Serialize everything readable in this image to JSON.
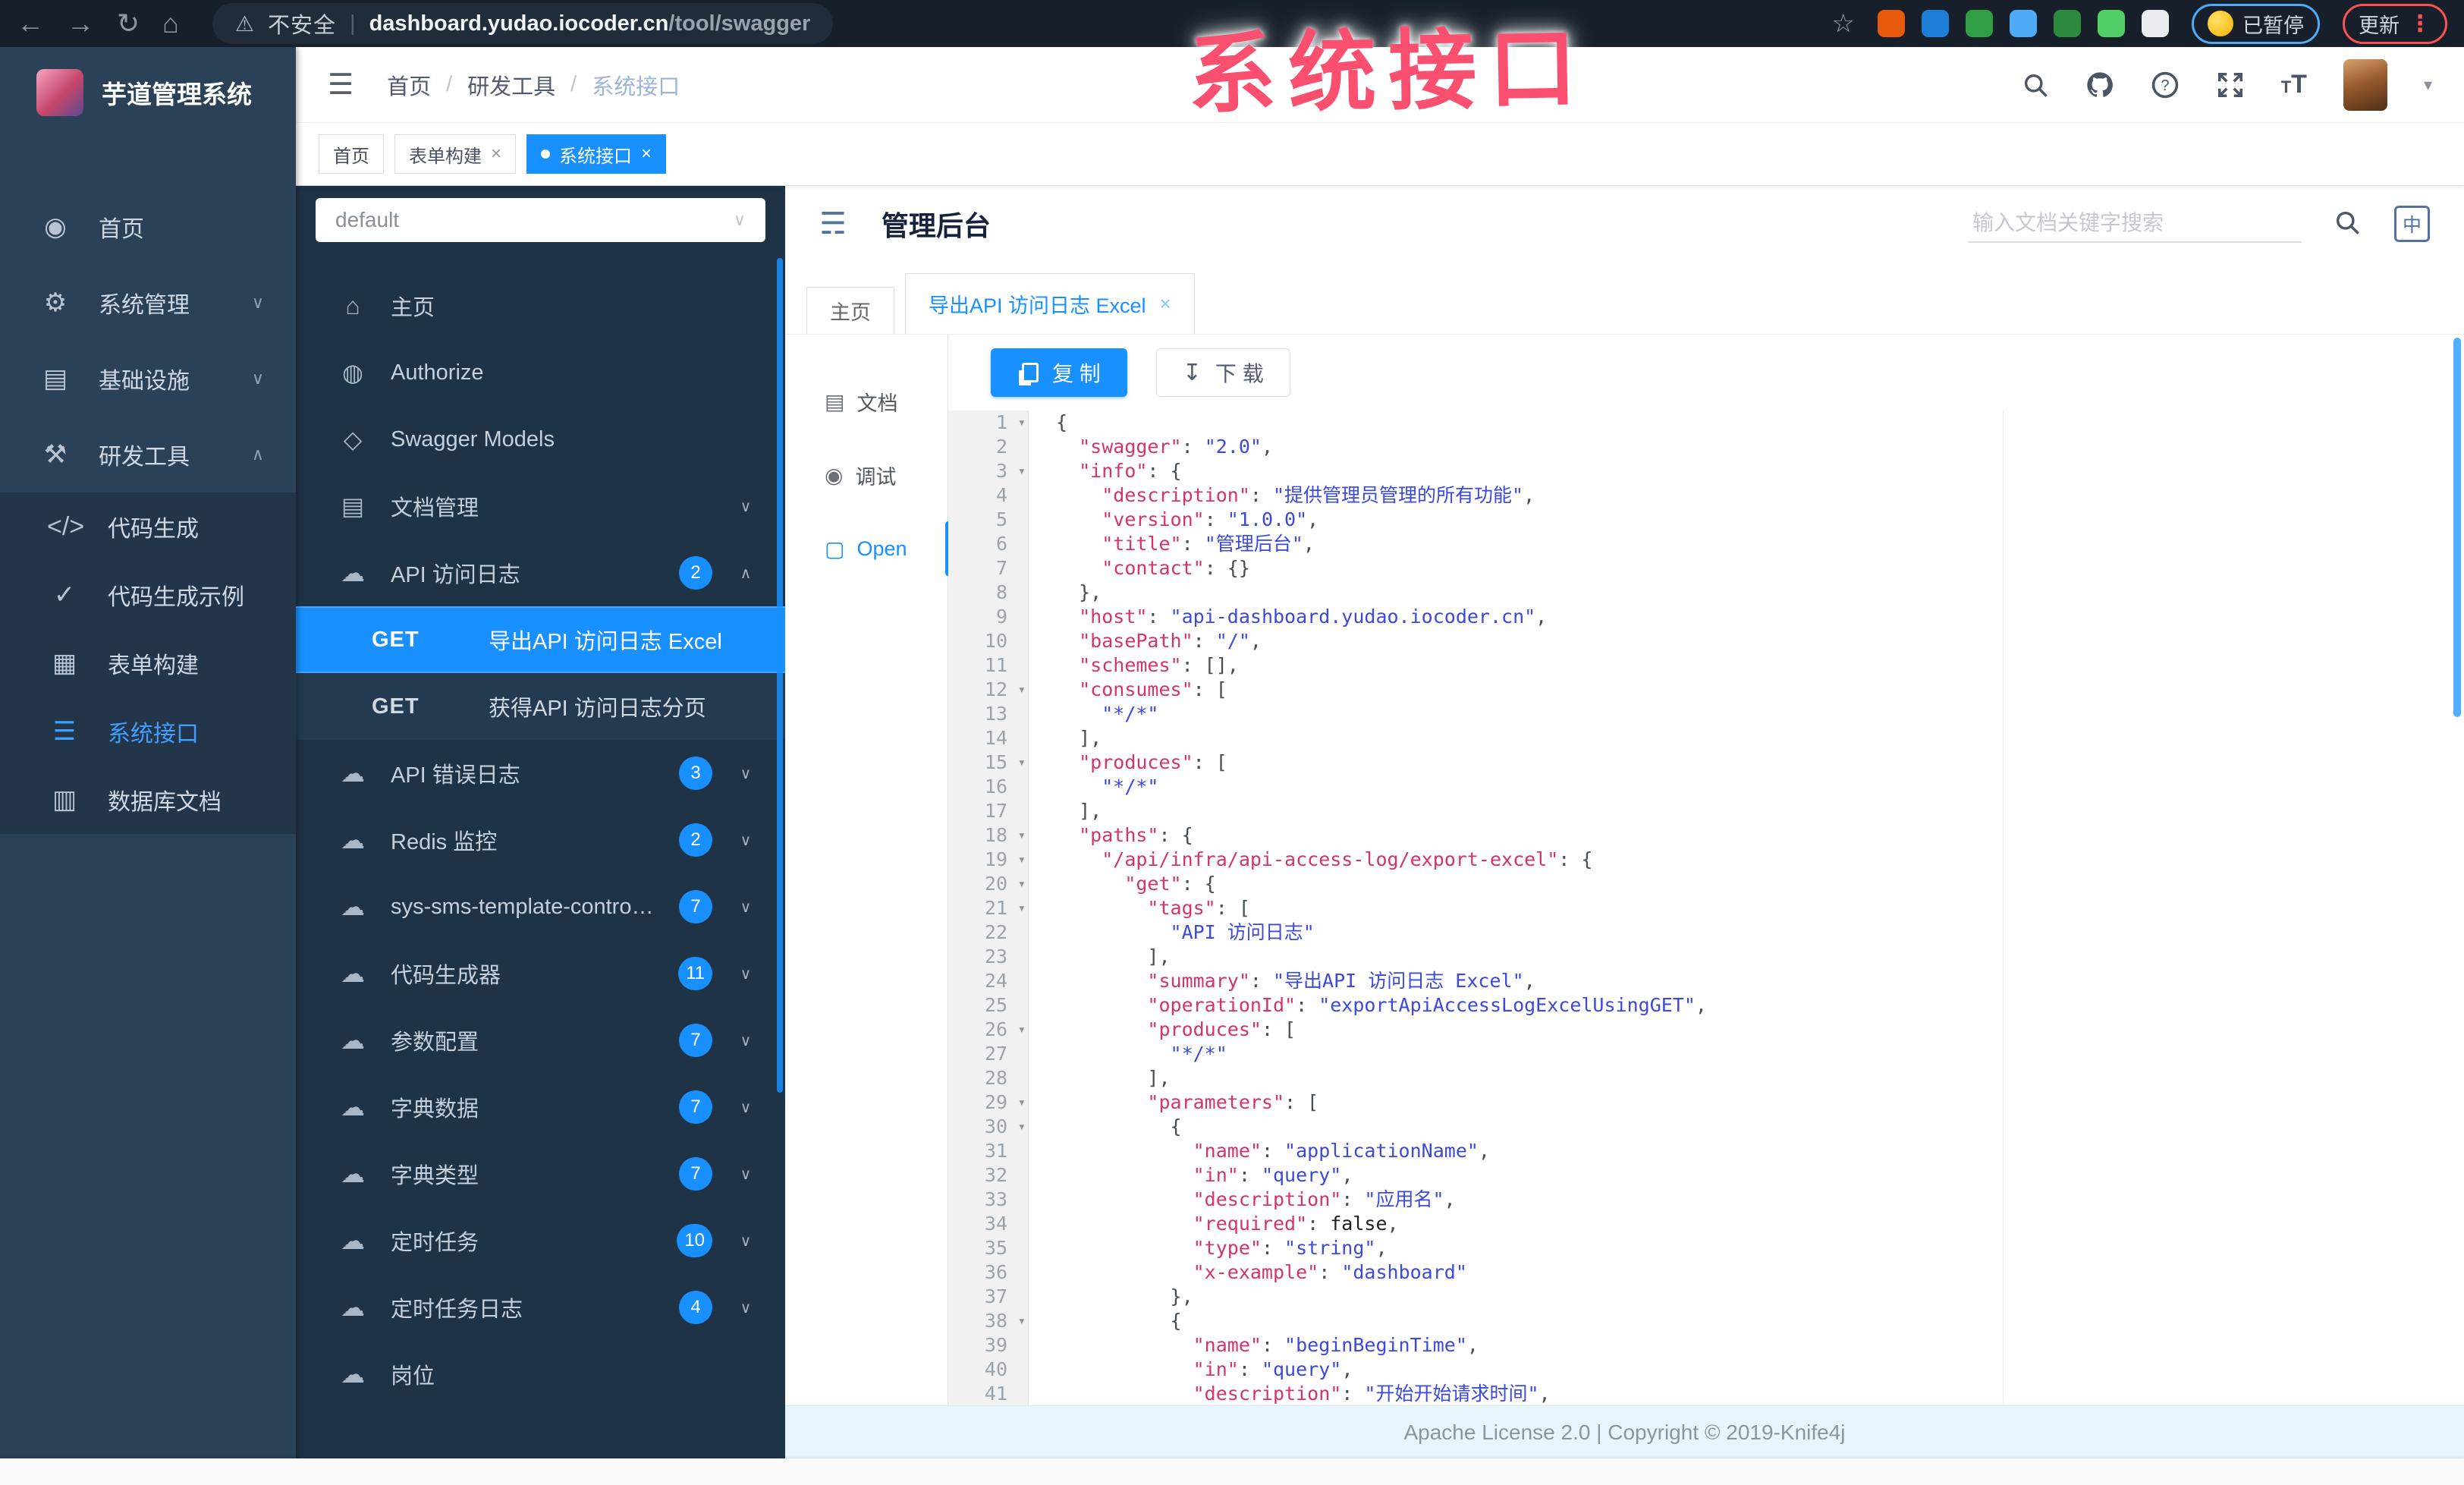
{
  "colors": {
    "accent": "#1890ff",
    "sidebar_bg": "#2b4158",
    "swagger_bg": "#1f3347",
    "key_color": "#d6336c",
    "str_color": "#3b49df",
    "overlay_pink": "#fb4f70"
  },
  "overlay_title": "系统接口",
  "browser": {
    "security_label": "不安全",
    "url_host": "dashboard.yudao.iocoder.cn",
    "url_path": "/tool/swagger",
    "paused_badge": "已暂停",
    "update_button": "更新",
    "extension_colors": [
      "#e8590c",
      "#1c7ed6",
      "#2f9e44",
      "#4dabf7",
      "#2b8a3e",
      "#51cf66",
      "#e9ecef"
    ]
  },
  "sidebar": {
    "app_title": "芋道管理系统",
    "menu": [
      {
        "name": "dashboard",
        "glyph": "◉",
        "label": "首页"
      },
      {
        "name": "system",
        "glyph": "⚙",
        "label": "系统管理",
        "chevron": "∨"
      },
      {
        "name": "infrastructure",
        "glyph": "▤",
        "label": "基础设施",
        "chevron": "∨"
      },
      {
        "name": "devtools",
        "glyph": "⚒",
        "label": "研发工具",
        "chevron": "∧"
      },
      {
        "name": "codegen",
        "glyph": "</>",
        "label": "代码生成",
        "sub": true
      },
      {
        "name": "codegen-demo",
        "glyph": "✓",
        "label": "代码生成示例",
        "sub": true
      },
      {
        "name": "form-builder",
        "glyph": "▦",
        "label": "表单构建",
        "sub": true
      },
      {
        "name": "system-api",
        "glyph": "☰",
        "label": "系统接口",
        "sub": true,
        "active": true
      },
      {
        "name": "db-doc",
        "glyph": "▥",
        "label": "数据库文档",
        "sub": true
      }
    ]
  },
  "breadcrumb": [
    "首页",
    "研发工具",
    "系统接口"
  ],
  "tag_tabs": [
    {
      "label": "首页"
    },
    {
      "label": "表单构建",
      "closable": true
    },
    {
      "label": "系统接口",
      "closable": true,
      "active": true
    }
  ],
  "swagger": {
    "group_select": "default",
    "menu": [
      {
        "type": "item",
        "name": "home",
        "glyph": "⌂",
        "label": "主页"
      },
      {
        "type": "item",
        "name": "authorize",
        "glyph": "◍",
        "label": "Authorize"
      },
      {
        "type": "item",
        "name": "swagger-models",
        "glyph": "◇",
        "label": "Swagger Models"
      },
      {
        "type": "item",
        "name": "doc-manage",
        "glyph": "▤",
        "label": "文档管理",
        "chevron": "∨"
      },
      {
        "type": "item",
        "name": "api-access-log",
        "glyph": "☁",
        "label": "API 访问日志",
        "badge": "2",
        "chevron": "∧"
      },
      {
        "type": "op",
        "method": "GET",
        "label": "导出API 访问日志 Excel",
        "active": true
      },
      {
        "type": "op",
        "method": "GET",
        "label": "获得API 访问日志分页"
      },
      {
        "type": "item",
        "name": "api-error-log",
        "glyph": "☁",
        "label": "API 错误日志",
        "badge": "3",
        "chevron": "∨"
      },
      {
        "type": "item",
        "name": "redis-monitor",
        "glyph": "☁",
        "label": "Redis 监控",
        "badge": "2",
        "chevron": "∨"
      },
      {
        "type": "item",
        "name": "sms-template",
        "glyph": "☁",
        "label": "sys-sms-template-controller",
        "badge": "7",
        "chevron": "∨"
      },
      {
        "type": "item",
        "name": "code-generator",
        "glyph": "☁",
        "label": "代码生成器",
        "badge": "11",
        "chevron": "∨"
      },
      {
        "type": "item",
        "name": "param-config",
        "glyph": "☁",
        "label": "参数配置",
        "badge": "7",
        "chevron": "∨"
      },
      {
        "type": "item",
        "name": "dict-data",
        "glyph": "☁",
        "label": "字典数据",
        "badge": "7",
        "chevron": "∨"
      },
      {
        "type": "item",
        "name": "dict-type",
        "glyph": "☁",
        "label": "字典类型",
        "badge": "7",
        "chevron": "∨"
      },
      {
        "type": "item",
        "name": "cron-job",
        "glyph": "☁",
        "label": "定时任务",
        "badge": "10",
        "chevron": "∨"
      },
      {
        "type": "item",
        "name": "cron-job-log",
        "glyph": "☁",
        "label": "定时任务日志",
        "badge": "4",
        "chevron": "∨"
      },
      {
        "type": "item",
        "name": "post",
        "glyph": "☁",
        "label": "岗位",
        "badge": "",
        "chevron": ""
      }
    ]
  },
  "doc": {
    "title": "管理后台",
    "search_placeholder": "输入文档关键字搜索",
    "lang_toggle": "中",
    "tabs": [
      {
        "label": "主页"
      },
      {
        "label": "导出API 访问日志 Excel",
        "closable": true,
        "active": true
      }
    ],
    "rail": [
      {
        "name": "doc",
        "glyph": "▤",
        "label": "文档"
      },
      {
        "name": "debug",
        "glyph": "◉",
        "label": "调试"
      },
      {
        "name": "open",
        "glyph": "▢",
        "label": "Open",
        "active": true
      }
    ],
    "copy_button": "复 制",
    "download_button": "下 载",
    "footer": "Apache License 2.0 | Copyright © 2019-Knife4j"
  },
  "code": {
    "lines": [
      {
        "n": 1,
        "f": true,
        "seg": [
          [
            "p",
            "{"
          ]
        ]
      },
      {
        "n": 2,
        "seg": [
          [
            "p",
            "  "
          ],
          [
            "k",
            "\"swagger\""
          ],
          [
            "p",
            ": "
          ],
          [
            "s",
            "\"2.0\""
          ],
          [
            "p",
            ","
          ]
        ]
      },
      {
        "n": 3,
        "f": true,
        "seg": [
          [
            "p",
            "  "
          ],
          [
            "k",
            "\"info\""
          ],
          [
            "p",
            ": {"
          ]
        ]
      },
      {
        "n": 4,
        "seg": [
          [
            "p",
            "    "
          ],
          [
            "k",
            "\"description\""
          ],
          [
            "p",
            ": "
          ],
          [
            "s",
            "\"提供管理员管理的所有功能\""
          ],
          [
            "p",
            ","
          ]
        ]
      },
      {
        "n": 5,
        "seg": [
          [
            "p",
            "    "
          ],
          [
            "k",
            "\"version\""
          ],
          [
            "p",
            ": "
          ],
          [
            "s",
            "\"1.0.0\""
          ],
          [
            "p",
            ","
          ]
        ]
      },
      {
        "n": 6,
        "seg": [
          [
            "p",
            "    "
          ],
          [
            "k",
            "\"title\""
          ],
          [
            "p",
            ": "
          ],
          [
            "s",
            "\"管理后台\""
          ],
          [
            "p",
            ","
          ]
        ]
      },
      {
        "n": 7,
        "seg": [
          [
            "p",
            "    "
          ],
          [
            "k",
            "\"contact\""
          ],
          [
            "p",
            ": {}"
          ]
        ]
      },
      {
        "n": 8,
        "seg": [
          [
            "p",
            "  },"
          ]
        ]
      },
      {
        "n": 9,
        "seg": [
          [
            "p",
            "  "
          ],
          [
            "k",
            "\"host\""
          ],
          [
            "p",
            ": "
          ],
          [
            "s",
            "\"api-dashboard.yudao.iocoder.cn\""
          ],
          [
            "p",
            ","
          ]
        ]
      },
      {
        "n": 10,
        "seg": [
          [
            "p",
            "  "
          ],
          [
            "k",
            "\"basePath\""
          ],
          [
            "p",
            ": "
          ],
          [
            "s",
            "\"/\""
          ],
          [
            "p",
            ","
          ]
        ]
      },
      {
        "n": 11,
        "seg": [
          [
            "p",
            "  "
          ],
          [
            "k",
            "\"schemes\""
          ],
          [
            "p",
            ": [],"
          ]
        ]
      },
      {
        "n": 12,
        "f": true,
        "seg": [
          [
            "p",
            "  "
          ],
          [
            "k",
            "\"consumes\""
          ],
          [
            "p",
            ": ["
          ]
        ]
      },
      {
        "n": 13,
        "seg": [
          [
            "p",
            "    "
          ],
          [
            "s",
            "\"*/*\""
          ]
        ]
      },
      {
        "n": 14,
        "seg": [
          [
            "p",
            "  ],"
          ]
        ]
      },
      {
        "n": 15,
        "f": true,
        "seg": [
          [
            "p",
            "  "
          ],
          [
            "k",
            "\"produces\""
          ],
          [
            "p",
            ": ["
          ]
        ]
      },
      {
        "n": 16,
        "seg": [
          [
            "p",
            "    "
          ],
          [
            "s",
            "\"*/*\""
          ]
        ]
      },
      {
        "n": 17,
        "seg": [
          [
            "p",
            "  ],"
          ]
        ]
      },
      {
        "n": 18,
        "f": true,
        "seg": [
          [
            "p",
            "  "
          ],
          [
            "k",
            "\"paths\""
          ],
          [
            "p",
            ": {"
          ]
        ]
      },
      {
        "n": 19,
        "f": true,
        "seg": [
          [
            "p",
            "    "
          ],
          [
            "k",
            "\"/api/infra/api-access-log/export-excel\""
          ],
          [
            "p",
            ": {"
          ]
        ]
      },
      {
        "n": 20,
        "f": true,
        "seg": [
          [
            "p",
            "      "
          ],
          [
            "k",
            "\"get\""
          ],
          [
            "p",
            ": {"
          ]
        ]
      },
      {
        "n": 21,
        "f": true,
        "seg": [
          [
            "p",
            "        "
          ],
          [
            "k",
            "\"tags\""
          ],
          [
            "p",
            ": ["
          ]
        ]
      },
      {
        "n": 22,
        "seg": [
          [
            "p",
            "          "
          ],
          [
            "s",
            "\"API 访问日志\""
          ]
        ]
      },
      {
        "n": 23,
        "seg": [
          [
            "p",
            "        ],"
          ]
        ]
      },
      {
        "n": 24,
        "seg": [
          [
            "p",
            "        "
          ],
          [
            "k",
            "\"summary\""
          ],
          [
            "p",
            ": "
          ],
          [
            "s",
            "\"导出API 访问日志 Excel\""
          ],
          [
            "p",
            ","
          ]
        ]
      },
      {
        "n": 25,
        "seg": [
          [
            "p",
            "        "
          ],
          [
            "k",
            "\"operationId\""
          ],
          [
            "p",
            ": "
          ],
          [
            "s",
            "\"exportApiAccessLogExcelUsingGET\""
          ],
          [
            "p",
            ","
          ]
        ]
      },
      {
        "n": 26,
        "f": true,
        "seg": [
          [
            "p",
            "        "
          ],
          [
            "k",
            "\"produces\""
          ],
          [
            "p",
            ": ["
          ]
        ]
      },
      {
        "n": 27,
        "seg": [
          [
            "p",
            "          "
          ],
          [
            "s",
            "\"*/*\""
          ]
        ]
      },
      {
        "n": 28,
        "seg": [
          [
            "p",
            "        ],"
          ]
        ]
      },
      {
        "n": 29,
        "f": true,
        "seg": [
          [
            "p",
            "        "
          ],
          [
            "k",
            "\"parameters\""
          ],
          [
            "p",
            ": ["
          ]
        ]
      },
      {
        "n": 30,
        "f": true,
        "seg": [
          [
            "p",
            "          {"
          ]
        ]
      },
      {
        "n": 31,
        "seg": [
          [
            "p",
            "            "
          ],
          [
            "k",
            "\"name\""
          ],
          [
            "p",
            ": "
          ],
          [
            "s",
            "\"applicationName\""
          ],
          [
            "p",
            ","
          ]
        ]
      },
      {
        "n": 32,
        "seg": [
          [
            "p",
            "            "
          ],
          [
            "k",
            "\"in\""
          ],
          [
            "p",
            ": "
          ],
          [
            "s",
            "\"query\""
          ],
          [
            "p",
            ","
          ]
        ]
      },
      {
        "n": 33,
        "seg": [
          [
            "p",
            "            "
          ],
          [
            "k",
            "\"description\""
          ],
          [
            "p",
            ": "
          ],
          [
            "s",
            "\"应用名\""
          ],
          [
            "p",
            ","
          ]
        ]
      },
      {
        "n": 34,
        "seg": [
          [
            "p",
            "            "
          ],
          [
            "k",
            "\"required\""
          ],
          [
            "p",
            ": "
          ],
          [
            "b",
            "false"
          ],
          [
            "p",
            ","
          ]
        ]
      },
      {
        "n": 35,
        "seg": [
          [
            "p",
            "            "
          ],
          [
            "k",
            "\"type\""
          ],
          [
            "p",
            ": "
          ],
          [
            "s",
            "\"string\""
          ],
          [
            "p",
            ","
          ]
        ]
      },
      {
        "n": 36,
        "seg": [
          [
            "p",
            "            "
          ],
          [
            "k",
            "\"x-example\""
          ],
          [
            "p",
            ": "
          ],
          [
            "s",
            "\"dashboard\""
          ]
        ]
      },
      {
        "n": 37,
        "seg": [
          [
            "p",
            "          },"
          ]
        ]
      },
      {
        "n": 38,
        "f": true,
        "seg": [
          [
            "p",
            "          {"
          ]
        ]
      },
      {
        "n": 39,
        "seg": [
          [
            "p",
            "            "
          ],
          [
            "k",
            "\"name\""
          ],
          [
            "p",
            ": "
          ],
          [
            "s",
            "\"beginBeginTime\""
          ],
          [
            "p",
            ","
          ]
        ]
      },
      {
        "n": 40,
        "seg": [
          [
            "p",
            "            "
          ],
          [
            "k",
            "\"in\""
          ],
          [
            "p",
            ": "
          ],
          [
            "s",
            "\"query\""
          ],
          [
            "p",
            ","
          ]
        ]
      },
      {
        "n": 41,
        "seg": [
          [
            "p",
            "            "
          ],
          [
            "k",
            "\"description\""
          ],
          [
            "p",
            ": "
          ],
          [
            "s",
            "\"开始开始请求时间\""
          ],
          [
            "p",
            ","
          ]
        ]
      }
    ]
  }
}
